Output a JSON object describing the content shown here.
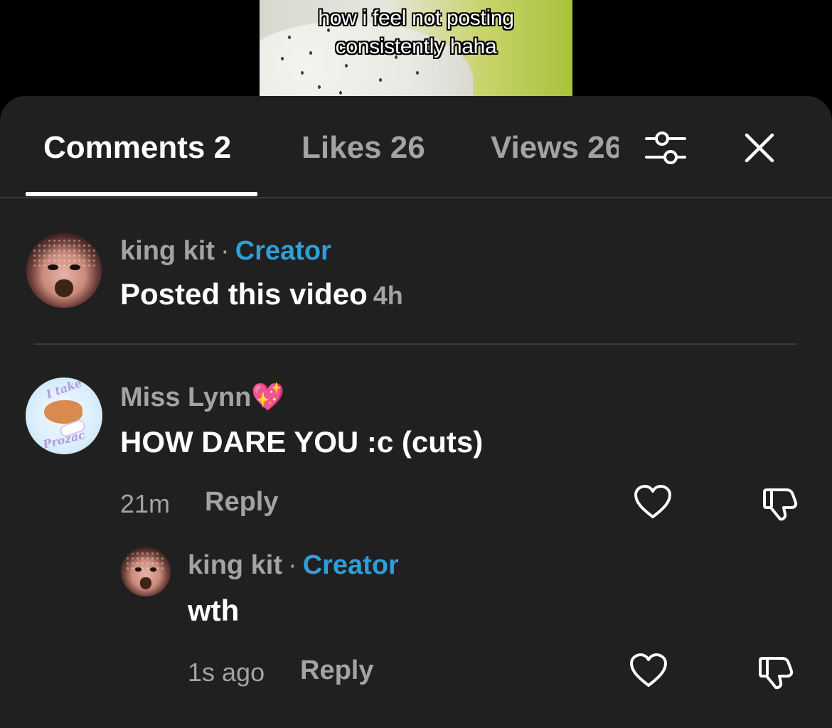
{
  "video": {
    "caption_line1": "how i feel not posting",
    "caption_line2": "consistently haha"
  },
  "tabs": [
    {
      "label": "Comments 2",
      "active": true
    },
    {
      "label": "Likes 26",
      "active": false
    },
    {
      "label": "Views 26",
      "active": false
    }
  ],
  "icons": {
    "filter": "sliders-icon",
    "close": "close-icon",
    "like": "heart-icon",
    "dislike": "thumbs-down-icon"
  },
  "colors": {
    "background": "#202020",
    "creator_badge": "#2e9fd8",
    "muted_text": "#a3a3a3",
    "primary_text": "#ffffff"
  },
  "creator_post": {
    "username": "king kit",
    "separator": "·",
    "badge": "Creator",
    "text": "Posted this video",
    "time": "4h"
  },
  "comments": [
    {
      "username": "Miss Lynn💖",
      "text": "HOW DARE YOU :c (cuts)",
      "time": "21m",
      "reply_label": "Reply",
      "avatar_text_top": "I take",
      "avatar_text_bottom": "Prozac",
      "replies": [
        {
          "username": "king kit",
          "separator": "·",
          "badge": "Creator",
          "text": "wth",
          "time": "1s ago",
          "reply_label": "Reply"
        }
      ]
    }
  ]
}
